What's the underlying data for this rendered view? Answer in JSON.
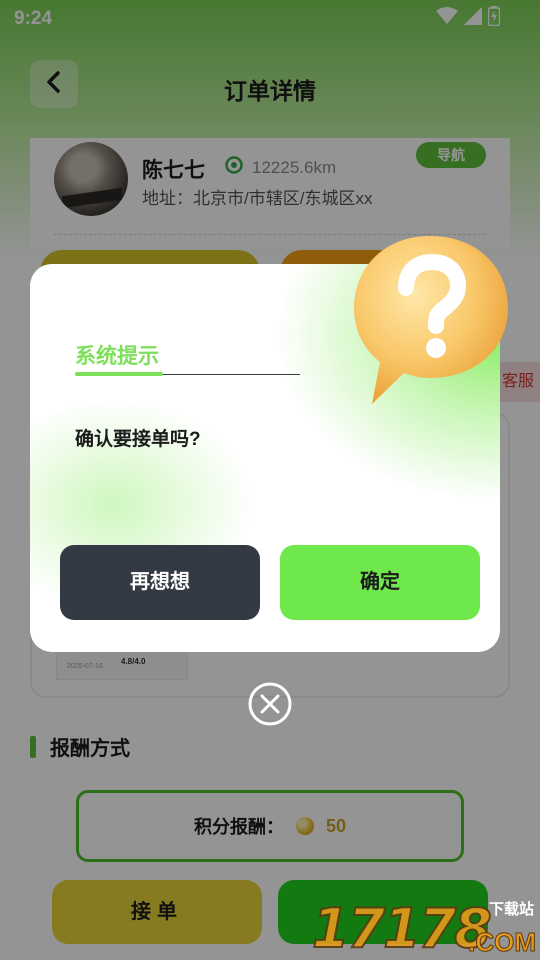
{
  "status_bar": {
    "time": "9:24"
  },
  "header": {
    "title": "订单详情"
  },
  "customer": {
    "name": "陈七七",
    "distance": "12225.6km",
    "nav_label": "导航",
    "address": "地址：北京市/市辖区/东城区xx"
  },
  "service_tag": "客服",
  "thumbnail": {
    "date": "2025-07-16",
    "score": "4.8/4.0"
  },
  "reward": {
    "section_title": "报酬方式",
    "points_label": "积分报酬：",
    "points_value": "50"
  },
  "bottom": {
    "accept_label": "接单"
  },
  "dialog": {
    "title": "系统提示",
    "message": "确认要接单吗?",
    "cancel_label": "再想想",
    "confirm_label": "确定"
  },
  "watermark": {
    "digits": "17178",
    "text": "下载站",
    "domain": ".COM"
  },
  "colors": {
    "accent_green": "#7de05a",
    "confirm_green": "#6ee84a",
    "cancel_dark": "#343a44",
    "accept_yellow": "#e7d43a"
  }
}
